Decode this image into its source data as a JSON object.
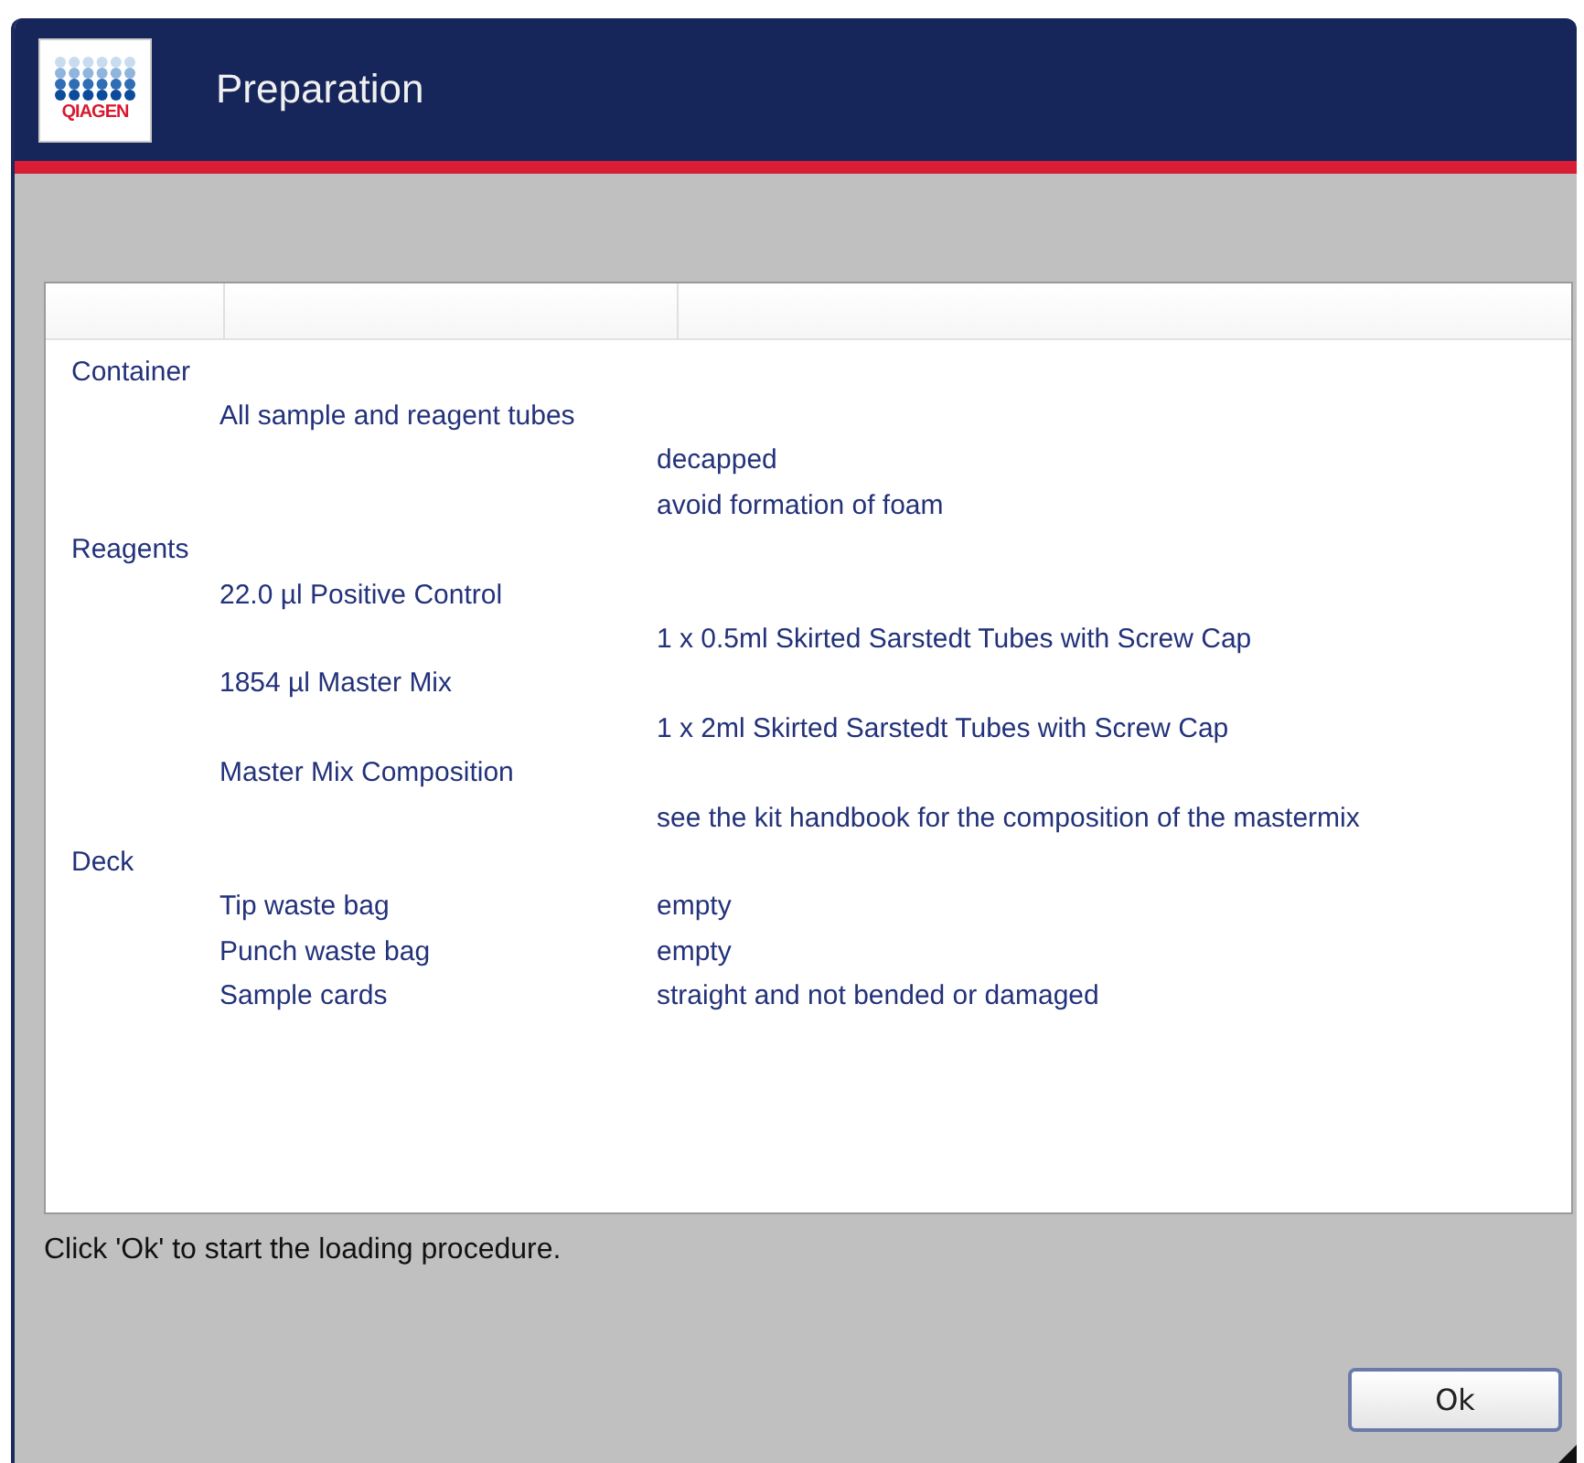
{
  "window": {
    "title": "Preparation",
    "logo_text": "QIAGEN"
  },
  "table": {
    "rows": [
      {
        "column_1": "Container"
      },
      {
        "column_2": "All sample and reagent tubes"
      },
      {
        "column_3": "decapped"
      },
      {
        "column_3": "avoid formation of foam"
      },
      {
        "column_1": "Reagents"
      },
      {
        "column_2": "22.0 µl Positive Control"
      },
      {
        "column_3": "1 x 0.5ml Skirted Sarstedt Tubes with Screw Cap"
      },
      {
        "column_2": "1854 µl Master Mix"
      },
      {
        "column_3": "1 x 2ml Skirted Sarstedt Tubes with Screw Cap"
      },
      {
        "column_2": "Master Mix Composition"
      },
      {
        "column_3": "see the kit handbook for the composition of the mastermix"
      },
      {
        "column_1": "Deck"
      },
      {
        "column_2": "Tip waste bag",
        "column_3": "empty"
      },
      {
        "column_2": "Punch waste bag",
        "column_3": "empty"
      },
      {
        "column_2": "Sample cards",
        "column_3": "straight and not bended or damaged"
      }
    ]
  },
  "message": "Click 'Ok' to start the loading procedure.",
  "buttons": [
    "Ok"
  ]
}
